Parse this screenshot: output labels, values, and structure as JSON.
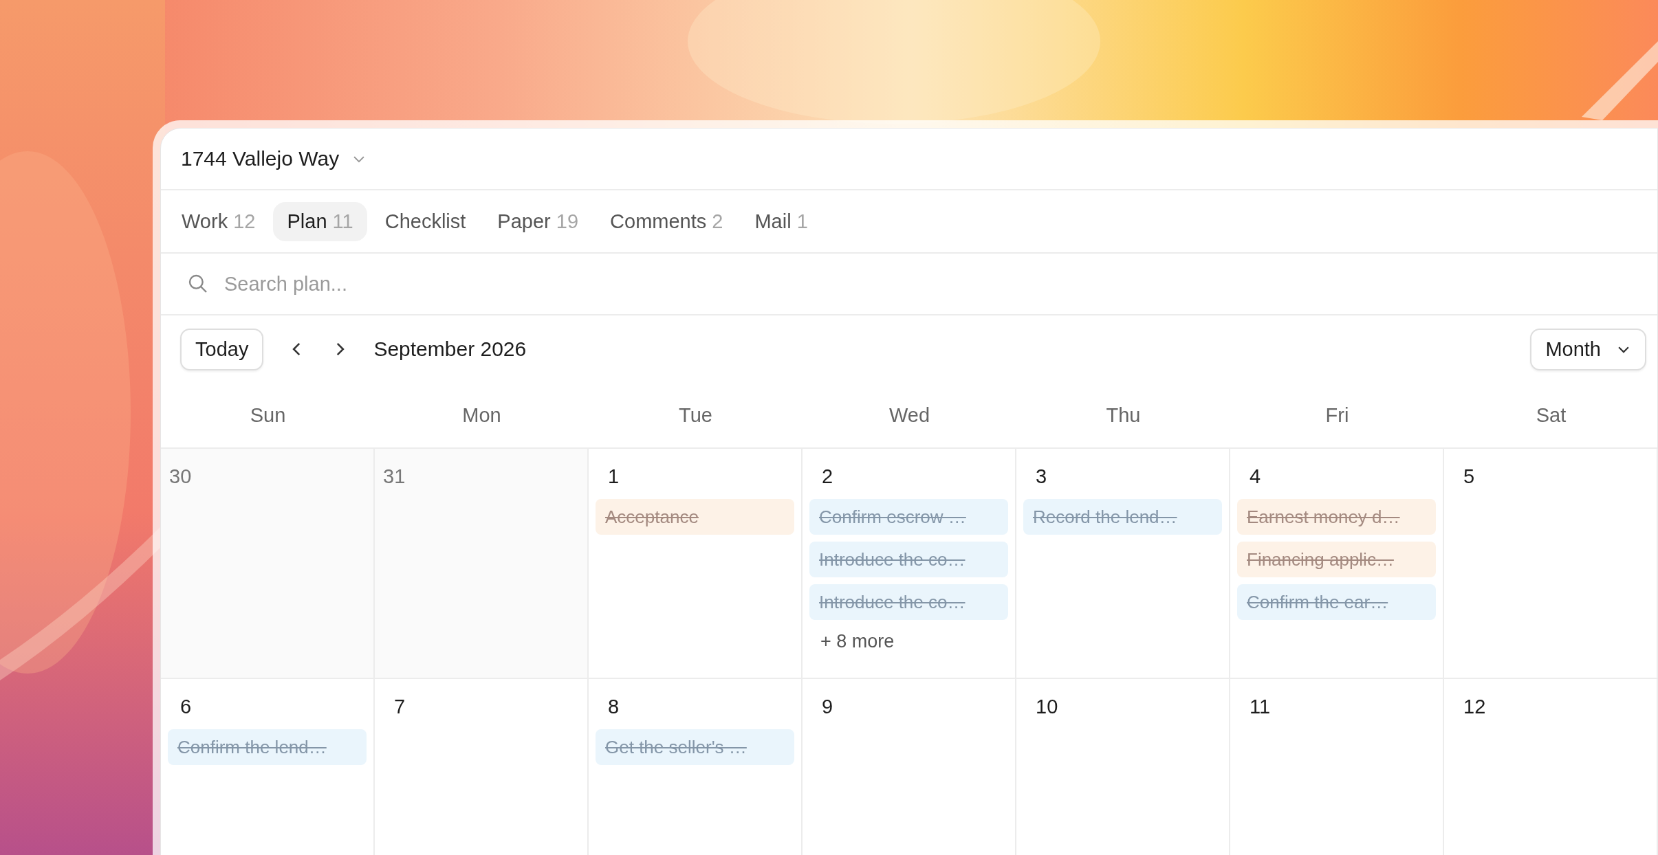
{
  "project": {
    "title": "1744 Vallejo Way"
  },
  "tabs": [
    {
      "label": "Work",
      "count": "12",
      "selected": false
    },
    {
      "label": "Plan",
      "count": "11",
      "selected": true
    },
    {
      "label": "Checklist",
      "selected": false
    },
    {
      "label": "Paper",
      "count": "19",
      "selected": false
    },
    {
      "label": "Comments",
      "count": "2",
      "selected": false
    },
    {
      "label": "Mail",
      "count": "1",
      "selected": false
    }
  ],
  "search": {
    "placeholder": "Search plan..."
  },
  "toolbar": {
    "today": "Today",
    "month_label": "September 2026",
    "view": "Month"
  },
  "weekdays": [
    "Sun",
    "Mon",
    "Tue",
    "Wed",
    "Thu",
    "Fri",
    "Sat"
  ],
  "weeks": [
    {
      "days": [
        {
          "day": "30",
          "outside": true
        },
        {
          "day": "31",
          "outside": true
        },
        {
          "day": "1",
          "outside": false,
          "events": [
            {
              "title": "Acceptance",
              "color": "#fdf2e7",
              "done": true
            }
          ]
        },
        {
          "day": "2",
          "outside": false,
          "events": [
            {
              "title": "Confirm escrow …",
              "color": "#eaf5fc",
              "done": true
            },
            {
              "title": "Introduce the co…",
              "color": "#eaf5fc",
              "done": true
            },
            {
              "title": "Introduce the co…",
              "color": "#eaf5fc",
              "done": true
            }
          ],
          "more": "+ 8 more"
        },
        {
          "day": "3",
          "outside": false,
          "events": [
            {
              "title": "Record the lend…",
              "color": "#eaf5fc",
              "done": true
            }
          ]
        },
        {
          "day": "4",
          "outside": false,
          "events": [
            {
              "title": "Earnest money d…",
              "color": "#fdf2e7",
              "done": true
            },
            {
              "title": "Financing applic…",
              "color": "#fdf2e7",
              "done": true
            },
            {
              "title": "Confirm the ear…",
              "color": "#eaf5fc",
              "done": true
            }
          ]
        },
        {
          "day": "5",
          "outside": false
        }
      ]
    },
    {
      "days": [
        {
          "day": "6",
          "outside": false,
          "events": [
            {
              "title": "Confirm the lend…",
              "color": "#eaf5fc",
              "done": true
            }
          ]
        },
        {
          "day": "7",
          "outside": false
        },
        {
          "day": "8",
          "outside": false,
          "events": [
            {
              "title": "Get the seller's …",
              "color": "#eaf5fc",
              "done": true
            }
          ]
        },
        {
          "day": "9",
          "outside": false
        },
        {
          "day": "10",
          "outside": false
        },
        {
          "day": "11",
          "outside": false
        },
        {
          "day": "12",
          "outside": false
        }
      ]
    }
  ]
}
